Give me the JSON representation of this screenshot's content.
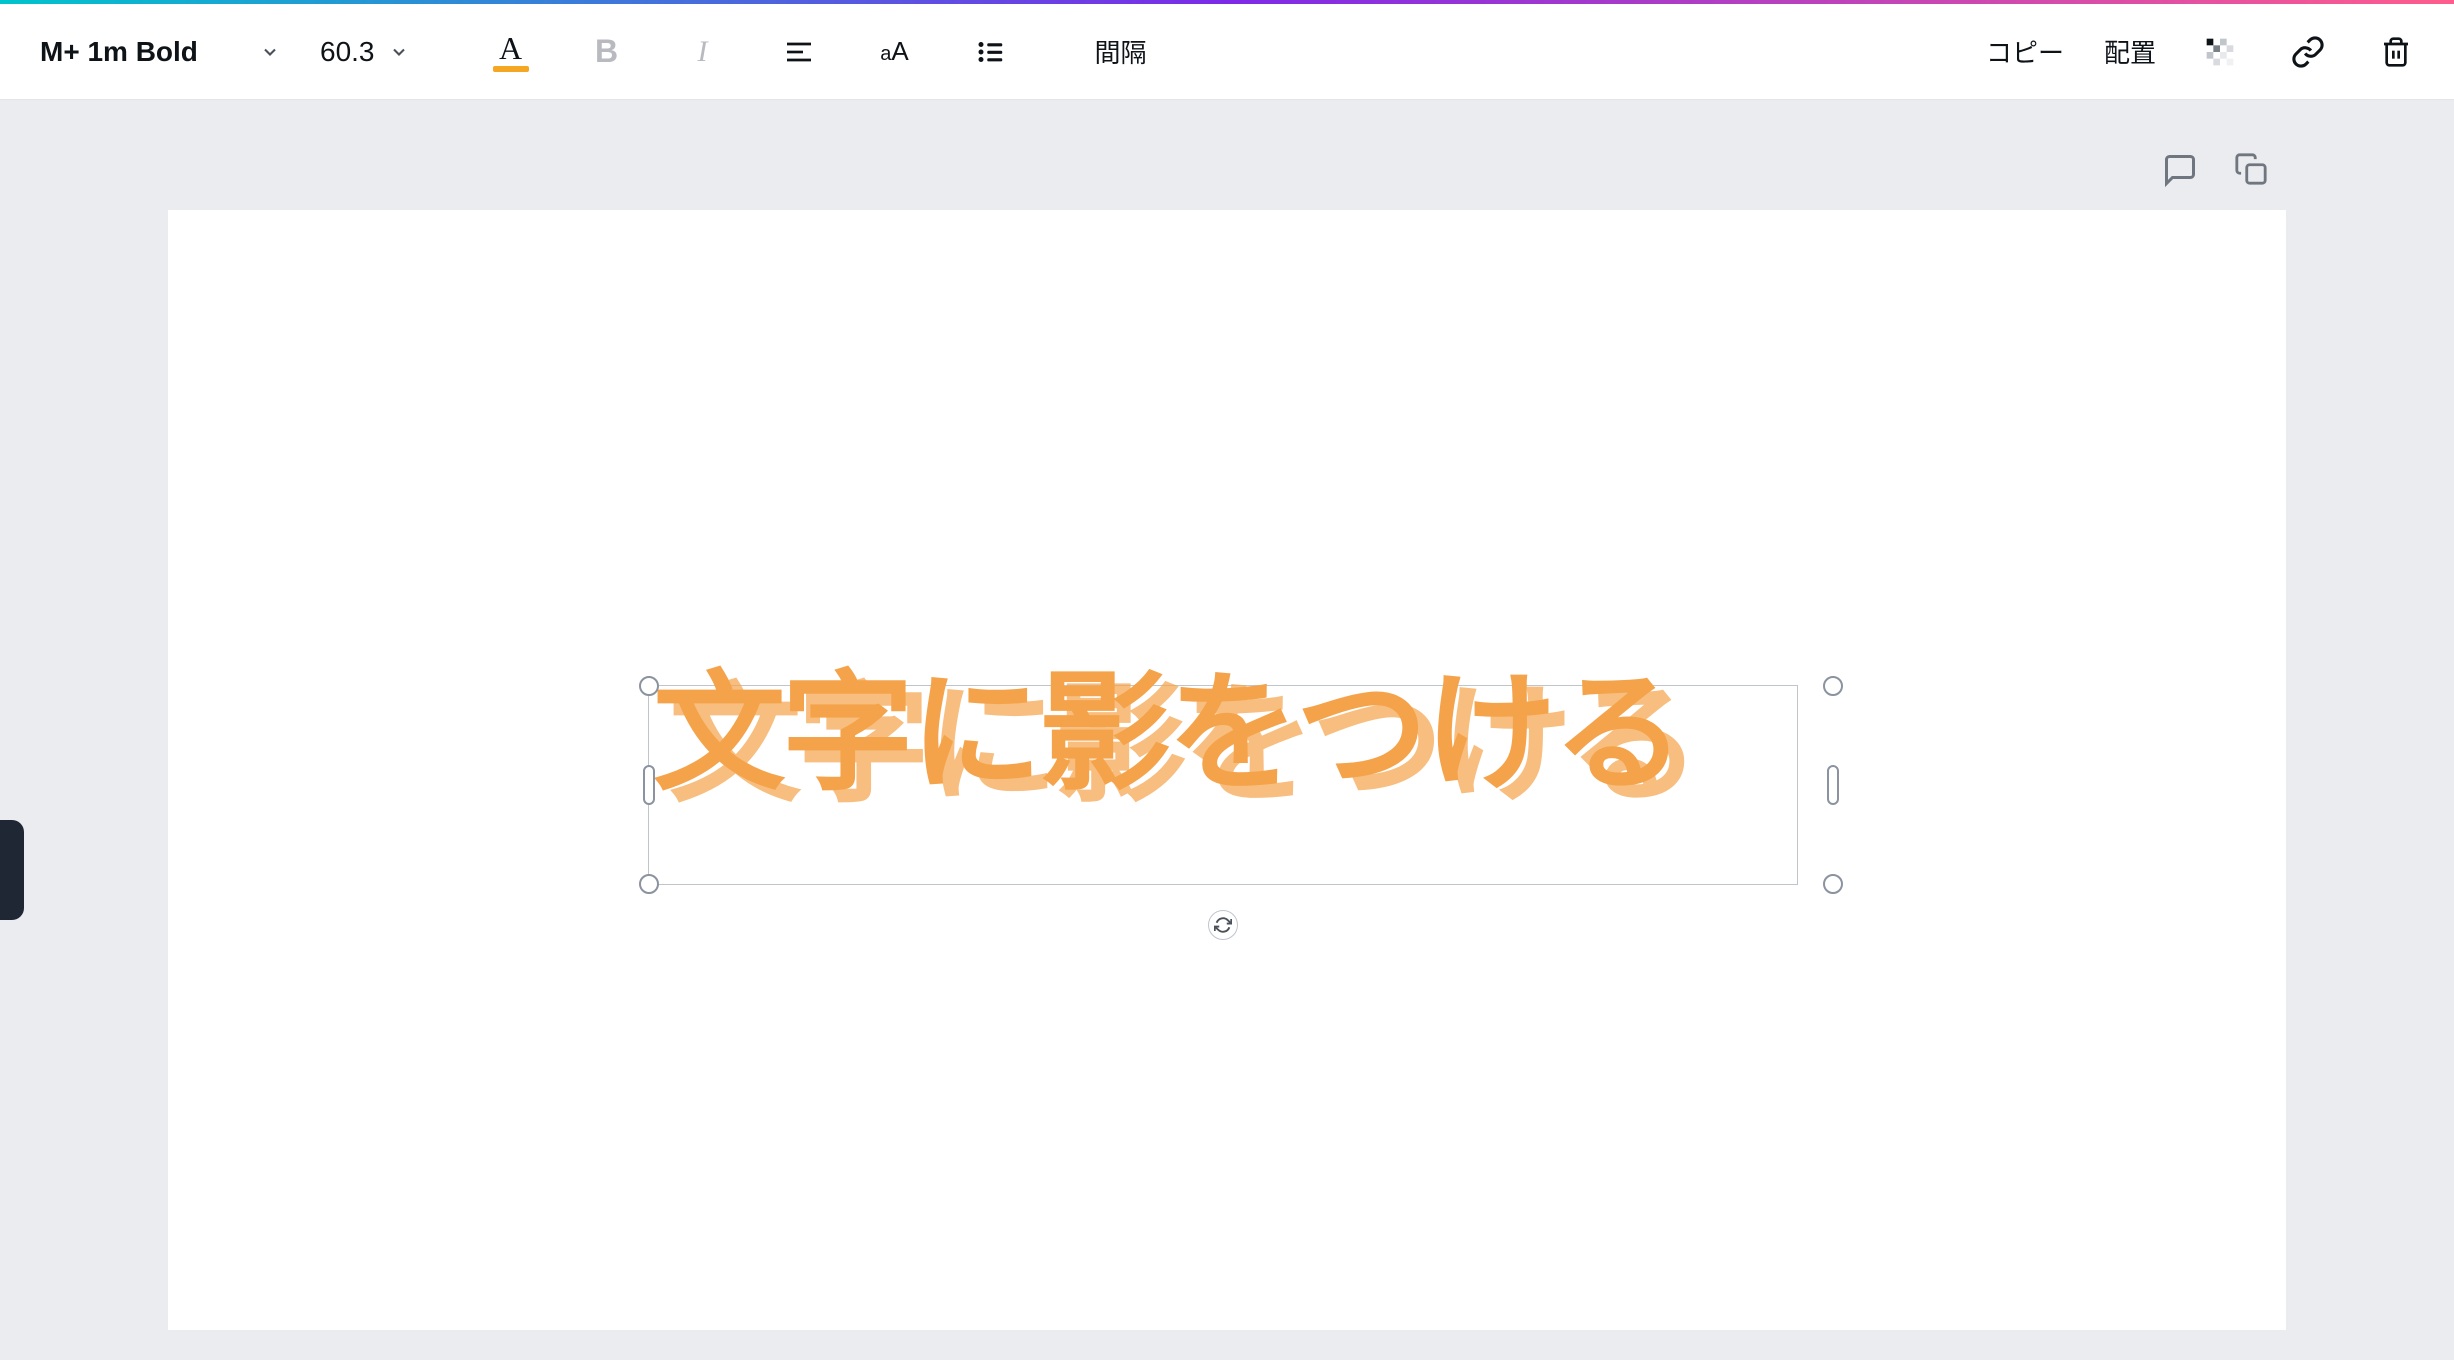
{
  "toolbar": {
    "font_name": "M+ 1m Bold",
    "font_size": "60.3",
    "spacing_label": "間隔",
    "copy_label": "コピー",
    "position_label": "配置",
    "text_color": "#f5a623"
  },
  "canvas": {
    "text_content": "文字に影をつける"
  },
  "icons": {
    "text_color": "A",
    "bold": "B",
    "italic": "I",
    "case": "aA"
  }
}
